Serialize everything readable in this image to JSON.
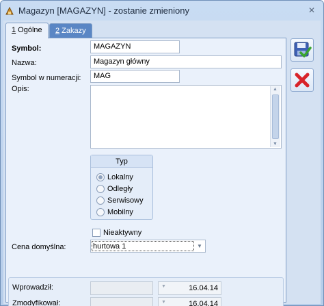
{
  "window": {
    "title": "Magazyn [MAGAZYN] - zostanie zmieniony",
    "close_glyph": "✕"
  },
  "tabs": [
    {
      "hotkey": "1",
      "label": " Ogólne"
    },
    {
      "hotkey": "2",
      "label": " Zakazy"
    }
  ],
  "form": {
    "symbol_label": "Symbol:",
    "symbol_value": "MAGAZYN",
    "nazwa_label": "Nazwa:",
    "nazwa_value": "Magazyn główny",
    "numeracja_label": "Symbol w numeracji:",
    "numeracja_value": "MAG",
    "opis_label": "Opis:",
    "opis_value": ""
  },
  "typ_group": {
    "title": "Typ",
    "options": [
      "Lokalny",
      "Odległy",
      "Serwisowy",
      "Mobilny"
    ],
    "selected": "Lokalny"
  },
  "nieaktywny": {
    "label": "Nieaktywny",
    "checked": false
  },
  "cena": {
    "label": "Cena domyślna:",
    "value": "hurtowa 1"
  },
  "audit": {
    "wprowadzil_label": "Wprowadził:",
    "wprowadzil_user": "",
    "wprowadzil_date": "16.04.14",
    "zmodyfikowal_label": "Zmodyfikował:",
    "zmodyfikowal_user": "",
    "zmodyfikowal_date": "16.04.14"
  },
  "actions": {
    "save_icon": "save-confirm-icon",
    "cancel_icon": "cancel-x-icon"
  },
  "colors": {
    "accent_tab": "#5a86c4",
    "save_check": "#3aa52f",
    "cancel_x": "#d8232a"
  }
}
